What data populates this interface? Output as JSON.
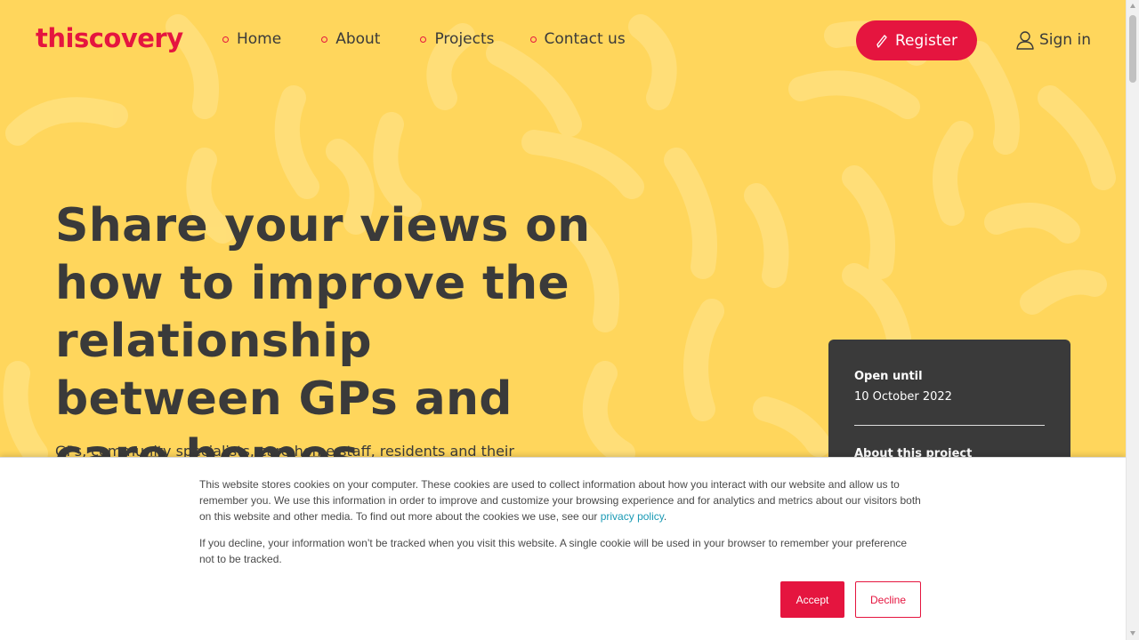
{
  "brand": {
    "logo_text": "thiscovery",
    "accent_color": "#e5153f",
    "background_color": "#ffd65c"
  },
  "nav": {
    "items": [
      {
        "label": "Home"
      },
      {
        "label": "About"
      },
      {
        "label": "Projects"
      },
      {
        "label": "Contact us"
      }
    ]
  },
  "header": {
    "register_label": "Register",
    "register_icon": "pencil-icon",
    "signin_label": "Sign in",
    "signin_icon": "user-icon"
  },
  "hero": {
    "title": "Share your views on how to improve the relationship between GPs and care homes",
    "subtitle": "GPs, community specialists, care home staff, residents and their"
  },
  "card": {
    "open_label": "Open until",
    "open_date": "10 October 2022",
    "about_label": "About this project"
  },
  "cookie_banner": {
    "paragraph1_text": "This website stores cookies on your computer. These cookies are used to collect information about how you interact with our website and allow us to remember you. We use this information in order to improve and customize your browsing experience and for analytics and metrics about our visitors both on this website and other media. To find out more about the cookies we use, see our ",
    "privacy_link": "privacy policy",
    "paragraph1_end": ".",
    "paragraph2_text": "If you decline, your information won’t be tracked when you visit this website. A single cookie will be used in your browser to remember your preference not to be tracked.",
    "accept_label": "Accept",
    "decline_label": "Decline"
  }
}
